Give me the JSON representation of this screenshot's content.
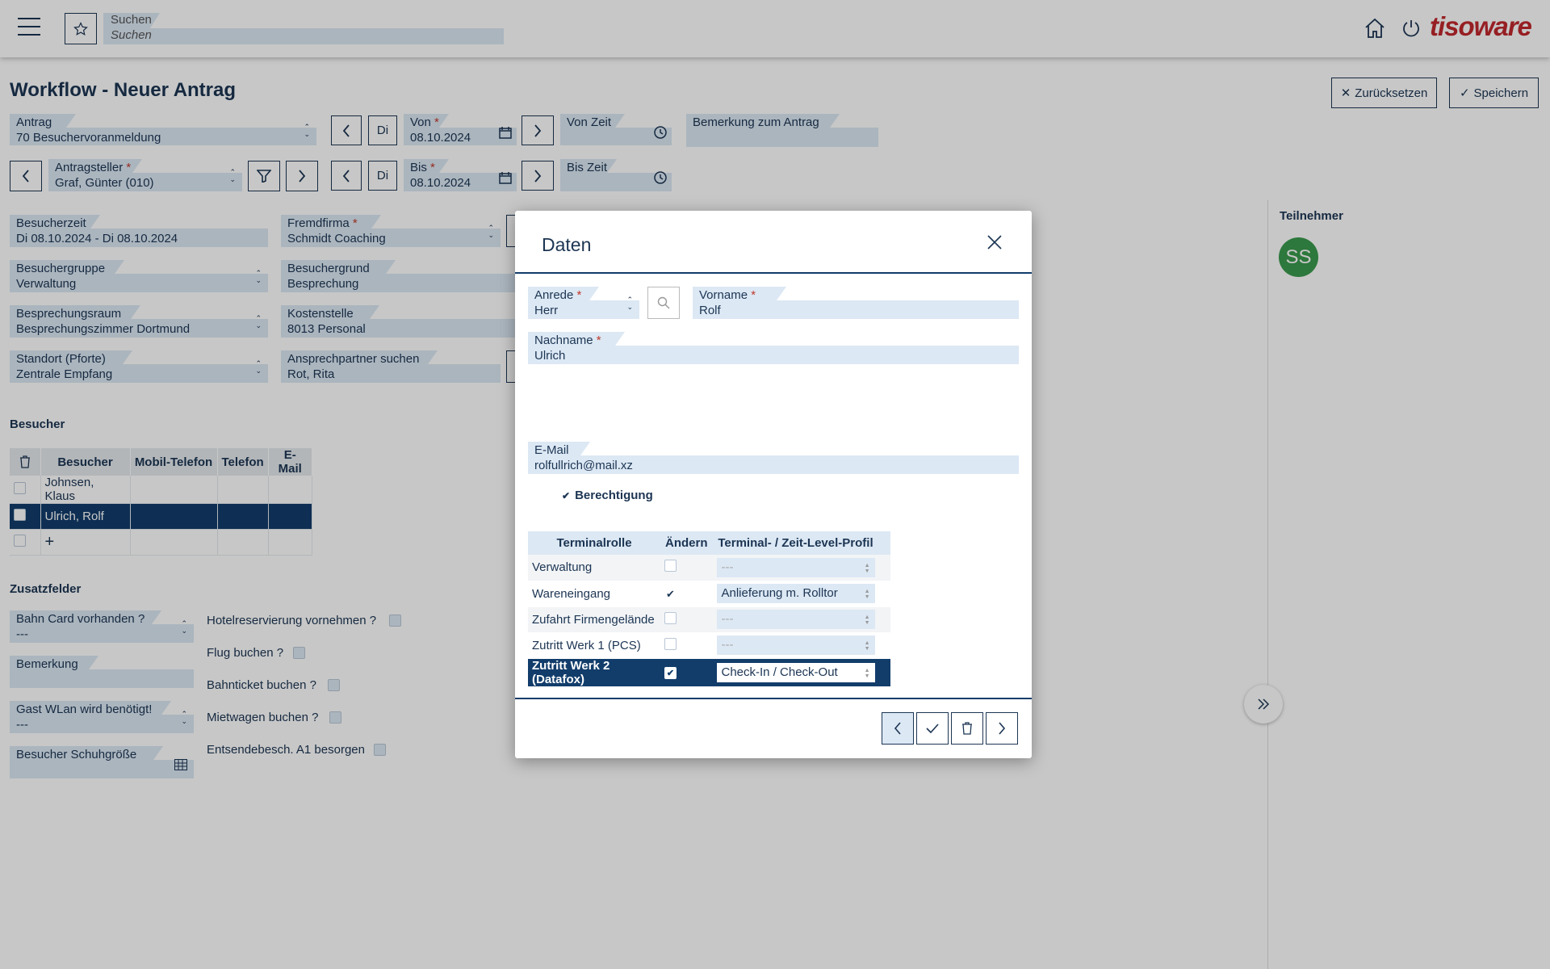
{
  "header": {
    "search_label": "Suchen",
    "search_placeholder": "Suchen",
    "brand": "tisoware"
  },
  "page": {
    "title": "Workflow - Neuer Antrag",
    "reset_label": "Zurücksetzen",
    "save_label": "Speichern"
  },
  "top_form": {
    "antrag_label": "Antrag",
    "antrag_value": "70 Besuchervoranmeldung",
    "day_label": "Di",
    "von_label": "Von",
    "von_value": "08.10.2024",
    "von_zeit_label": "Von Zeit",
    "bemerkung_label": "Bemerkung zum Antrag",
    "antragsteller_label": "Antragsteller",
    "antragsteller_value": "Graf, Günter (010)",
    "bis_label": "Bis",
    "bis_value": "08.10.2024",
    "bis_zeit_label": "Bis Zeit"
  },
  "visit_form": {
    "besucherzeit_label": "Besucherzeit",
    "besucherzeit_value": "Di 08.10.2024 - Di 08.10.2024",
    "fremdfirma_label": "Fremdfirma",
    "fremdfirma_value": "Schmidt Coaching",
    "besuchergruppe_label": "Besuchergruppe",
    "besuchergruppe_value": "Verwaltung",
    "besuchergrund_label": "Besuchergrund",
    "besuchergrund_value": "Besprechung",
    "raum_label": "Besprechungsraum",
    "raum_value": "Besprechungszimmer Dortmund",
    "kostenstelle_label": "Kostenstelle",
    "kostenstelle_value": "8013 Personal",
    "standort_label": "Standort (Pforte)",
    "standort_value": "Zentrale Empfang",
    "ansprech_label": "Ansprechpartner suchen",
    "ansprech_value": "Rot, Rita"
  },
  "besucher": {
    "title": "Besucher",
    "columns": [
      "Besucher",
      "Mobil-Telefon",
      "Telefon",
      "E-Mail"
    ],
    "rows": [
      "Johnsen, Klaus",
      "Ulrich, Rolf"
    ],
    "add_symbol": "+"
  },
  "zusatz": {
    "title": "Zusatzfelder",
    "bahncard_label": "Bahn Card vorhanden ?",
    "bahncard_value": "---",
    "bemerkung_label": "Bemerkung",
    "wlan_label": "Gast WLan wird benötigt!",
    "wlan_value": "---",
    "schuh_label": "Besucher Schuhgröße",
    "hotel_label": "Hotelreservierung vornehmen ?",
    "flug_label": "Flug buchen ?",
    "bahnticket_label": "Bahnticket buchen ?",
    "mietwagen_label": "Mietwagen buchen ?",
    "entsende_label": "Entsendebesch. A1 besorgen"
  },
  "teilnehmer": {
    "title": "Teilnehmer",
    "avatar_initials": "SS",
    "avatar_color": "#3a9a4e"
  },
  "modal": {
    "title": "Daten",
    "anrede_label": "Anrede",
    "anrede_value": "Herr",
    "vorname_label": "Vorname",
    "vorname_value": "Rolf",
    "nachname_label": "Nachname",
    "nachname_value": "Ulrich",
    "email_label": "E-Mail",
    "email_value": "rolfullrich@mail.xz",
    "berechtigung_label": "Berechtigung",
    "table_headers": [
      "Terminalrolle",
      "Ändern",
      "Terminal- / Zeit-Level-Profil"
    ],
    "rows": [
      {
        "role": "Verwaltung",
        "checked": false,
        "profile": "---"
      },
      {
        "role": "Wareneingang",
        "checked": true,
        "profile": "Anlieferung m. Rolltor"
      },
      {
        "role": "Zufahrt Firmengelände",
        "checked": false,
        "profile": "---"
      },
      {
        "role": "Zutritt Werk 1 (PCS)",
        "checked": false,
        "profile": "---"
      },
      {
        "role": "Zutritt Werk 2 (Datafox)",
        "checked": true,
        "profile": "Check-In / Check-Out"
      }
    ]
  },
  "colors": {
    "primary": "#1c3553",
    "selected_row": "#123d6b",
    "field_bg": "#dce8f4",
    "brand": "#c0282d"
  }
}
